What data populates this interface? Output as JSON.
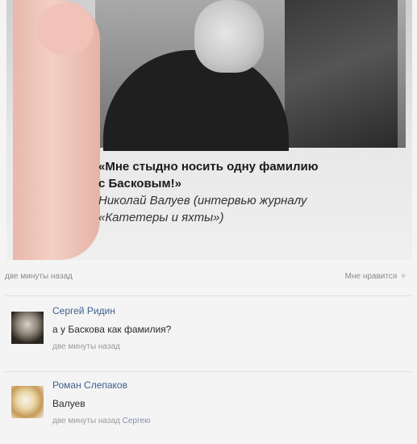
{
  "post": {
    "quote_line1": "«Мне стыдно носить одну фамилию",
    "quote_line2": "с Басковым!»",
    "attribution_line1": "Николай Валуев (интервью журналу",
    "attribution_line2": "«Катетеры и яхты»)",
    "time": "две минуты назад",
    "like_label": "Мне нравится",
    "like_icon": "heart-icon"
  },
  "comments": [
    {
      "author": "Сергей Ридин",
      "text": "а у Баскова как фамилия?",
      "time": "две минуты назад",
      "reply_to": ""
    },
    {
      "author": "Роман Слепаков",
      "text": "Валуев",
      "time": "две минуты назад",
      "reply_to": "Сергею"
    }
  ]
}
